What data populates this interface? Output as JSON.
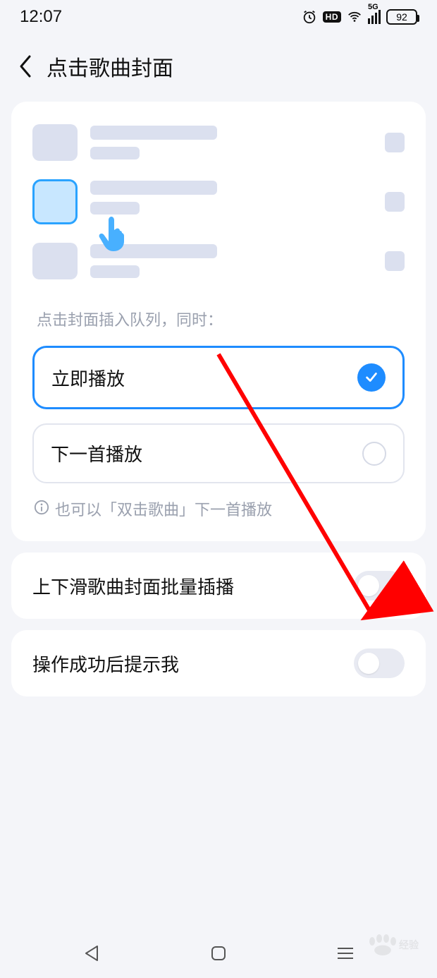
{
  "status_bar": {
    "time": "12:07",
    "hd_label": "HD",
    "network_label": "5G",
    "battery_percent": "92"
  },
  "header": {
    "title": "点击歌曲封面"
  },
  "main": {
    "hint": "点击封面插入队列，同时：",
    "options": [
      {
        "label": "立即播放",
        "selected": true
      },
      {
        "label": "下一首播放",
        "selected": false
      }
    ],
    "info_text": "也可以「双击歌曲」下一首播放"
  },
  "toggles": [
    {
      "label": "上下滑歌曲封面批量插播",
      "on": false
    },
    {
      "label": "操作成功后提示我",
      "on": false
    }
  ],
  "colors": {
    "accent": "#1e8cff",
    "arrow": "#ff0000"
  },
  "watermark": "Baidu 经验"
}
